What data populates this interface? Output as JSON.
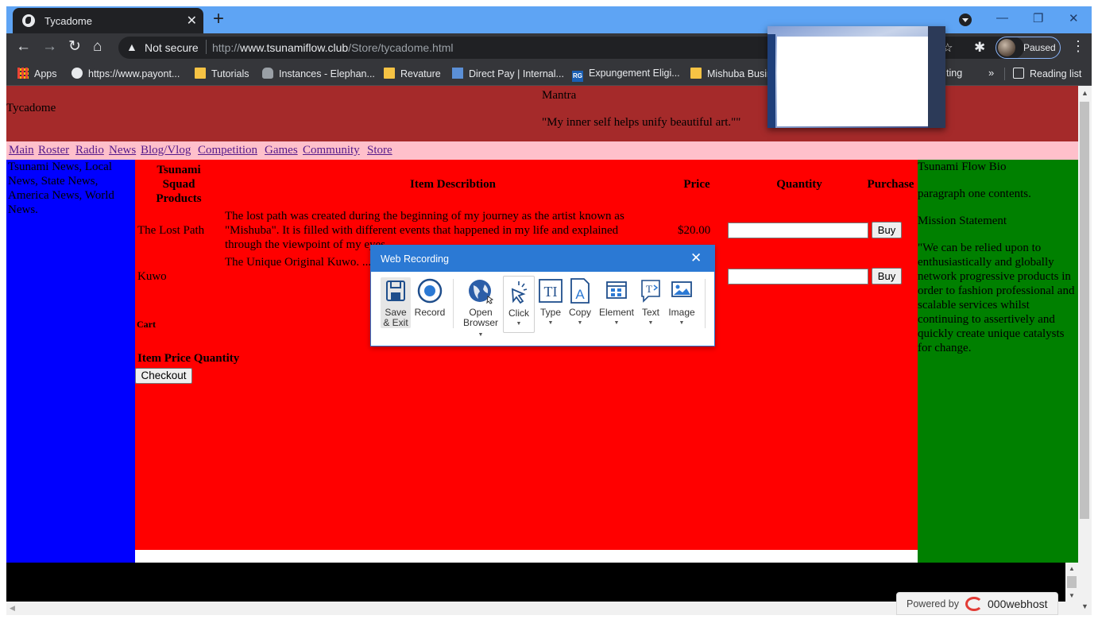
{
  "browser": {
    "tab_title": "Tycadome",
    "tab_close": "✕",
    "new_tab": "+",
    "security": "Not secure",
    "url_prefix": "http://",
    "url_domain": "www.tsunamiflow.club",
    "url_path": "/Store/tycadome.html",
    "profile_status": "Paused",
    "bookmarks": [
      "Apps",
      "https://www.payont...",
      "Tutorials",
      "Instances - Elephan...",
      "Revature",
      "Direct Pay | Internal...",
      "Expungement Eligi...",
      "Mishuba Busin",
      "ting"
    ],
    "bookmarks_more": "»",
    "reading_list": "Reading list"
  },
  "page": {
    "site_title": "Tycadome",
    "mantra_label": "Mantra",
    "mantra_text": "\"My inner self helps unify beautiful art.\"\"",
    "nav": [
      "Main",
      "Roster",
      "Radio",
      "News",
      "Blog/Vlog",
      "Competition",
      "Games",
      "Community",
      "Store"
    ],
    "left_sidebar": "Tsunami News, Local News, State News, America News, World News.",
    "table": {
      "headers": {
        "product": "Tsunami Squad Products",
        "description": "Item Describtion",
        "price": "Price",
        "quantity": "Quantity",
        "purchase": "Purchase"
      },
      "rows": [
        {
          "product": "The Lost Path",
          "description": "The lost path was created during the beginning of my journey as the artist known as \"Mishuba\". It is filled with different events that happened in my life and explained through the viewpoint of my eyes.",
          "price": "$20.00",
          "buy": "Buy"
        },
        {
          "product": "Kuwo",
          "description": "The Unique Original Kuwo. ... hustlers. There is an infinte a... to choose?",
          "price": "",
          "buy": "Buy"
        }
      ]
    },
    "cart_label": "Cart",
    "cart_headers": "Item Price Quantity",
    "checkout": "Checkout",
    "right_sidebar": {
      "bio_title": "Tsunami Flow Bio",
      "bio_text": "paragraph one contents.",
      "mission_title": "Mission Statement",
      "mission_text": "\"We can be relied upon to enthusiastically and globally network progressive products in order to fashion professional and scalable services whilst continuing to assertively and quickly create unique catalysts for change."
    },
    "powered_by": "Powered by",
    "powered_brand": "000webhost"
  },
  "recorder": {
    "title": "Web Recording",
    "close": "✕",
    "tools": [
      {
        "label": "Save & Exit",
        "icon": "save-icon"
      },
      {
        "label": "Record",
        "icon": "record-icon"
      },
      {
        "label": "Open Browser",
        "icon": "globe-icon"
      },
      {
        "label": "Click",
        "icon": "click-icon"
      },
      {
        "label": "Type",
        "icon": "type-icon"
      },
      {
        "label": "Copy",
        "icon": "copy-icon"
      },
      {
        "label": "Element",
        "icon": "element-icon"
      },
      {
        "label": "Text",
        "icon": "text-icon"
      },
      {
        "label": "Image",
        "icon": "image-icon"
      }
    ]
  },
  "colors": {
    "header": "#a52a2a",
    "nav": "#ffc0cb",
    "left": "#0000ff",
    "main": "#ff0000",
    "right": "#008000",
    "recorder_accent": "#2b79d4"
  }
}
